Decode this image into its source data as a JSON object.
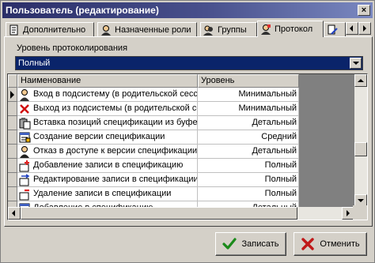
{
  "window": {
    "title": "Пользователь (редактирование)",
    "close_glyph": "×"
  },
  "tabs": [
    {
      "label": "Дополнительно",
      "icon": "document-icon"
    },
    {
      "label": "Назначенные роли",
      "icon": "person-icon"
    },
    {
      "label": "Группы",
      "icon": "group-icon"
    },
    {
      "label": "Протокол",
      "icon": "protocol-icon",
      "active": true
    }
  ],
  "logging": {
    "label": "Уровень протоколирования",
    "value": "Полный"
  },
  "table": {
    "columns": [
      "Наименование",
      "Уровень"
    ],
    "rows": [
      {
        "icon": "login-icon",
        "name": "Вход в подсистему (в родительской сессии)",
        "level": "Минимальный",
        "current": true
      },
      {
        "icon": "logout-icon",
        "name": "Выход из подсистемы (в родительской сессии)",
        "level": "Минимальный"
      },
      {
        "icon": "paste-icon",
        "name": "Вставка позиций спецификации из буфера",
        "level": "Детальный"
      },
      {
        "icon": "spec-icon",
        "name": "Создание версии спецификации",
        "level": "Средний"
      },
      {
        "icon": "access-denied-icon",
        "name": "Отказ в доступе к версии спецификации",
        "level": "Детальный"
      },
      {
        "icon": "add-record-icon",
        "name": "Добавление записи в спецификацию",
        "level": "Полный"
      },
      {
        "icon": "edit-record-icon",
        "name": "Редактирование записи в спецификации",
        "level": "Полный"
      },
      {
        "icon": "delete-record-icon",
        "name": "Удаление записи в спецификации",
        "level": "Полный"
      },
      {
        "icon": "spec-add-icon",
        "name": "Добавление в спецификацию",
        "level": "Детальный"
      }
    ]
  },
  "buttons": {
    "save": "Записать",
    "cancel": "Отменить"
  },
  "colors": {
    "selection": "#0a246a",
    "title_start": "#2a2e68",
    "face": "#d4d0c8"
  }
}
